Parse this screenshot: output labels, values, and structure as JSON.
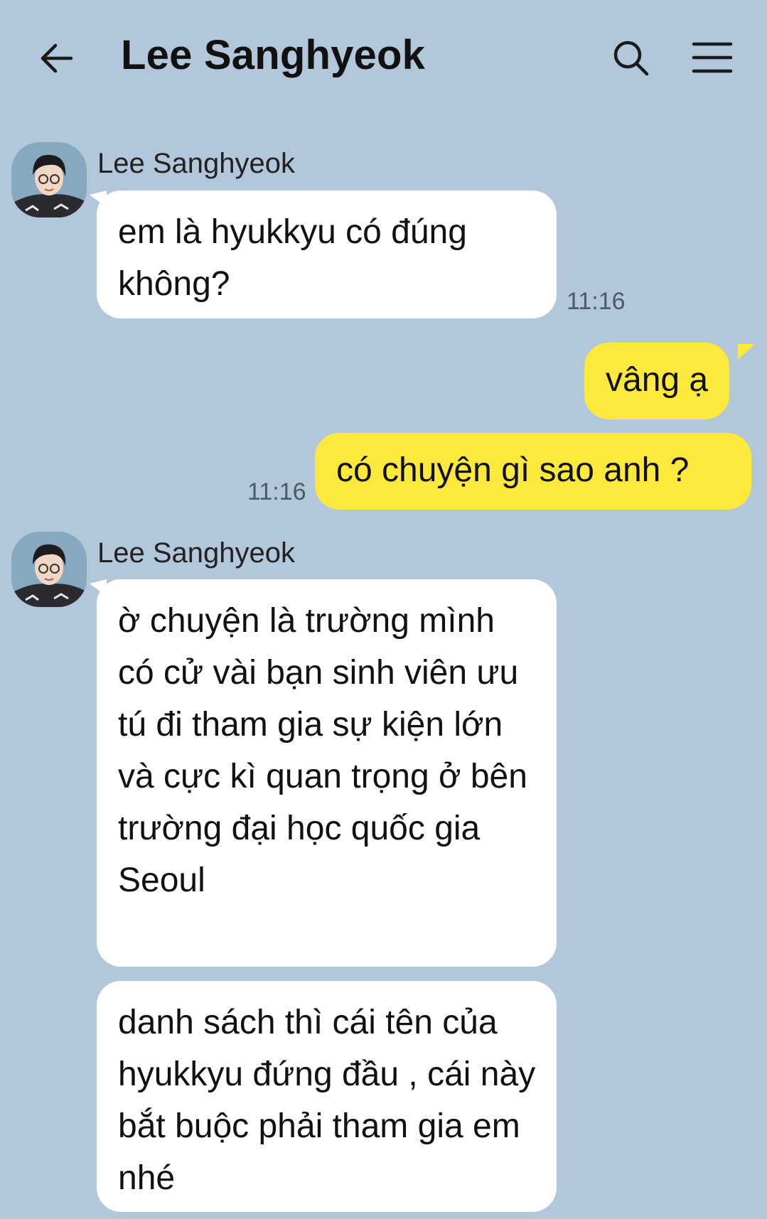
{
  "header": {
    "title": "Lee Sanghyeok",
    "back_icon": "arrow-left-icon",
    "search_icon": "search-icon",
    "menu_icon": "hamburger-menu-icon"
  },
  "colors": {
    "background": "#b2c7da",
    "incoming_bubble": "#ffffff",
    "outgoing_bubble": "#fde93c"
  },
  "messages": [
    {
      "sender": "Lee Sanghyeok",
      "direction": "incoming",
      "text": "em là hyukkyu có đúng không?",
      "time": "11:16"
    },
    {
      "direction": "outgoing",
      "text": "vâng ạ"
    },
    {
      "direction": "outgoing",
      "text": "có chuyện gì sao anh ?",
      "time": "11:16"
    },
    {
      "sender": "Lee Sanghyeok",
      "direction": "incoming",
      "text": "ờ chuyện là trường mình có cử vài bạn sinh viên ưu tú đi tham gia sự kiện lớn và cực kì quan trọng ở bên trường đại học quốc gia Seoul"
    },
    {
      "direction": "incoming",
      "text": "danh sách thì cái tên của hyukkyu đứng đầu , cái này bắt buộc phải tham gia em nhé"
    }
  ]
}
